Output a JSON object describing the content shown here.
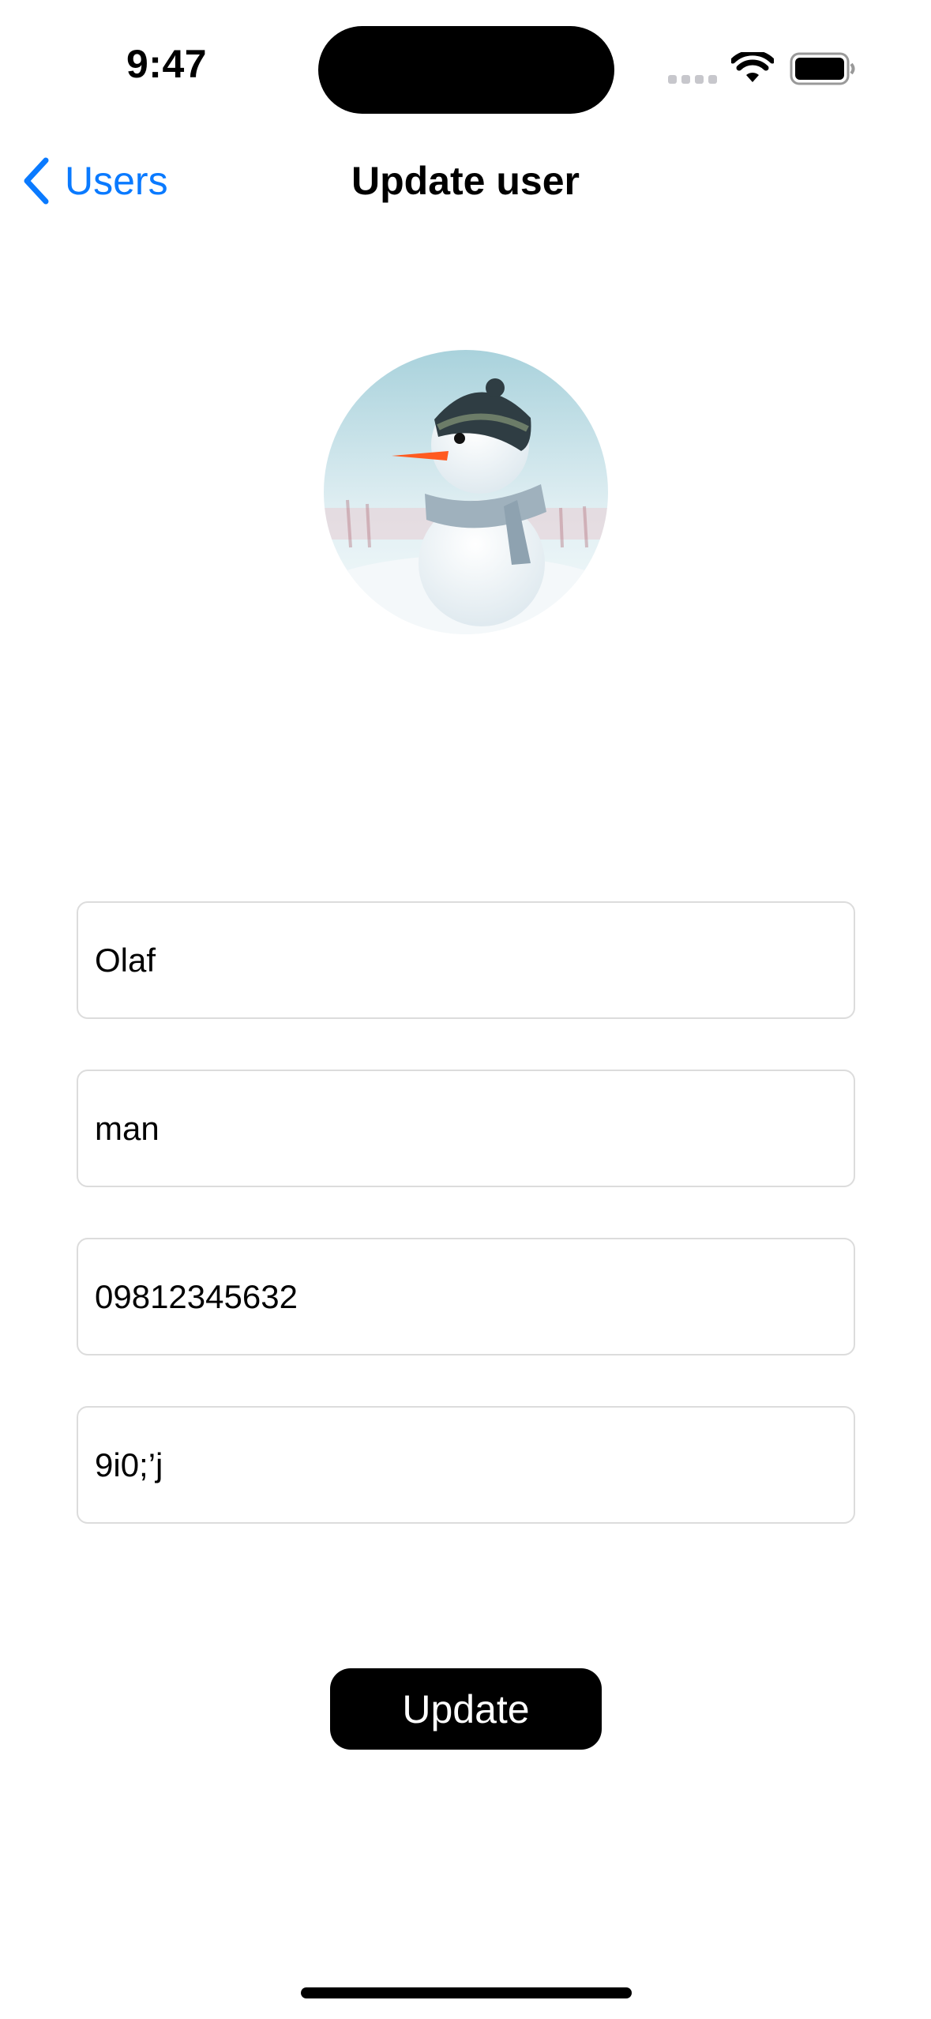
{
  "status_bar": {
    "time": "9:47"
  },
  "nav": {
    "back_label": "Users",
    "title": "Update user"
  },
  "fields": [
    {
      "value": "Olaf"
    },
    {
      "value": "man"
    },
    {
      "value": "09812345632"
    },
    {
      "value": "9i0;’j"
    }
  ],
  "actions": {
    "update_label": "Update"
  },
  "icons": {
    "back": "chevron-left-icon",
    "wifi": "wifi-icon",
    "battery": "battery-icon",
    "signal": "cellular-signal-icon"
  },
  "colors": {
    "accent": "#0a7aff",
    "button_bg": "#000000",
    "field_border": "#dcdcdc"
  }
}
